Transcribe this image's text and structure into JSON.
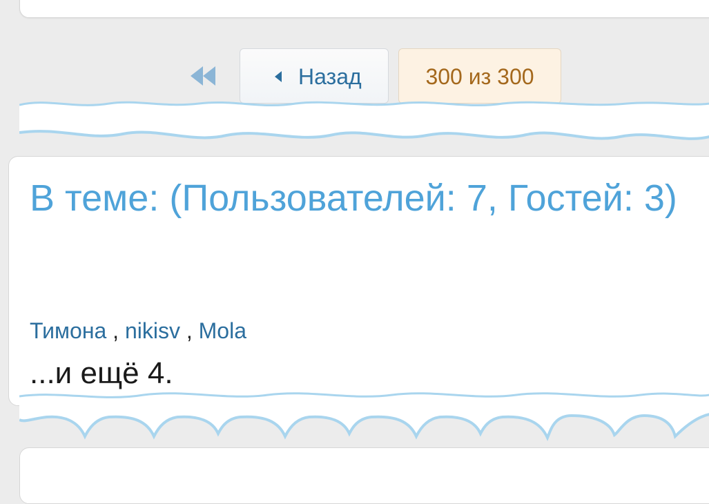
{
  "pager": {
    "first_icon": "double-chevron-left-icon",
    "back_icon": "caret-left-icon",
    "back_label": "Назад",
    "counter": "300 из 300"
  },
  "online": {
    "title": "В теме: (Пользователей: 7, Гостей: 3)",
    "users": [
      "Тимона",
      "nikisv",
      "Mola"
    ],
    "separator": ",",
    "more": "...и ещё 4."
  },
  "colors": {
    "accent": "#4fa3d9",
    "link": "#2b6e9e",
    "counter_bg": "#fdf2e3",
    "counter_text": "#a4681c",
    "wave": "#a9d5ee"
  }
}
